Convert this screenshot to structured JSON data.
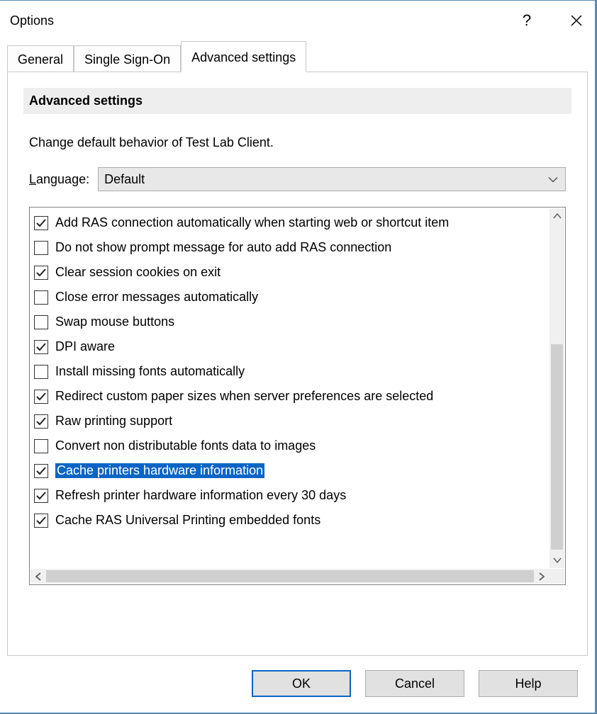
{
  "window": {
    "title": "Options"
  },
  "tabs": {
    "general": "General",
    "sso": "Single Sign-On",
    "advanced": "Advanced settings"
  },
  "panel": {
    "header": "Advanced settings",
    "description": "Change default behavior of Test Lab Client.",
    "language_label_pre": "L",
    "language_label_rest": "anguage:",
    "language_value": "Default"
  },
  "items": [
    {
      "checked": true,
      "selected": false,
      "label": "Add RAS connection automatically when starting web or shortcut item"
    },
    {
      "checked": false,
      "selected": false,
      "label": "Do not show prompt message for auto add RAS connection"
    },
    {
      "checked": true,
      "selected": false,
      "label": "Clear session cookies on exit"
    },
    {
      "checked": false,
      "selected": false,
      "label": "Close error messages automatically"
    },
    {
      "checked": false,
      "selected": false,
      "label": "Swap mouse buttons"
    },
    {
      "checked": true,
      "selected": false,
      "label": "DPI aware"
    },
    {
      "checked": false,
      "selected": false,
      "label": "Install missing fonts automatically"
    },
    {
      "checked": true,
      "selected": false,
      "label": "Redirect custom paper sizes when server preferences are selected"
    },
    {
      "checked": true,
      "selected": false,
      "label": "Raw printing support"
    },
    {
      "checked": false,
      "selected": false,
      "label": "Convert non distributable fonts data to images"
    },
    {
      "checked": true,
      "selected": true,
      "label": "Cache printers hardware information"
    },
    {
      "checked": true,
      "selected": false,
      "label": "Refresh printer hardware information every 30 days"
    },
    {
      "checked": true,
      "selected": false,
      "label": "Cache RAS Universal Printing embedded fonts"
    }
  ],
  "buttons": {
    "ok": "OK",
    "cancel": "Cancel",
    "help": "Help"
  }
}
